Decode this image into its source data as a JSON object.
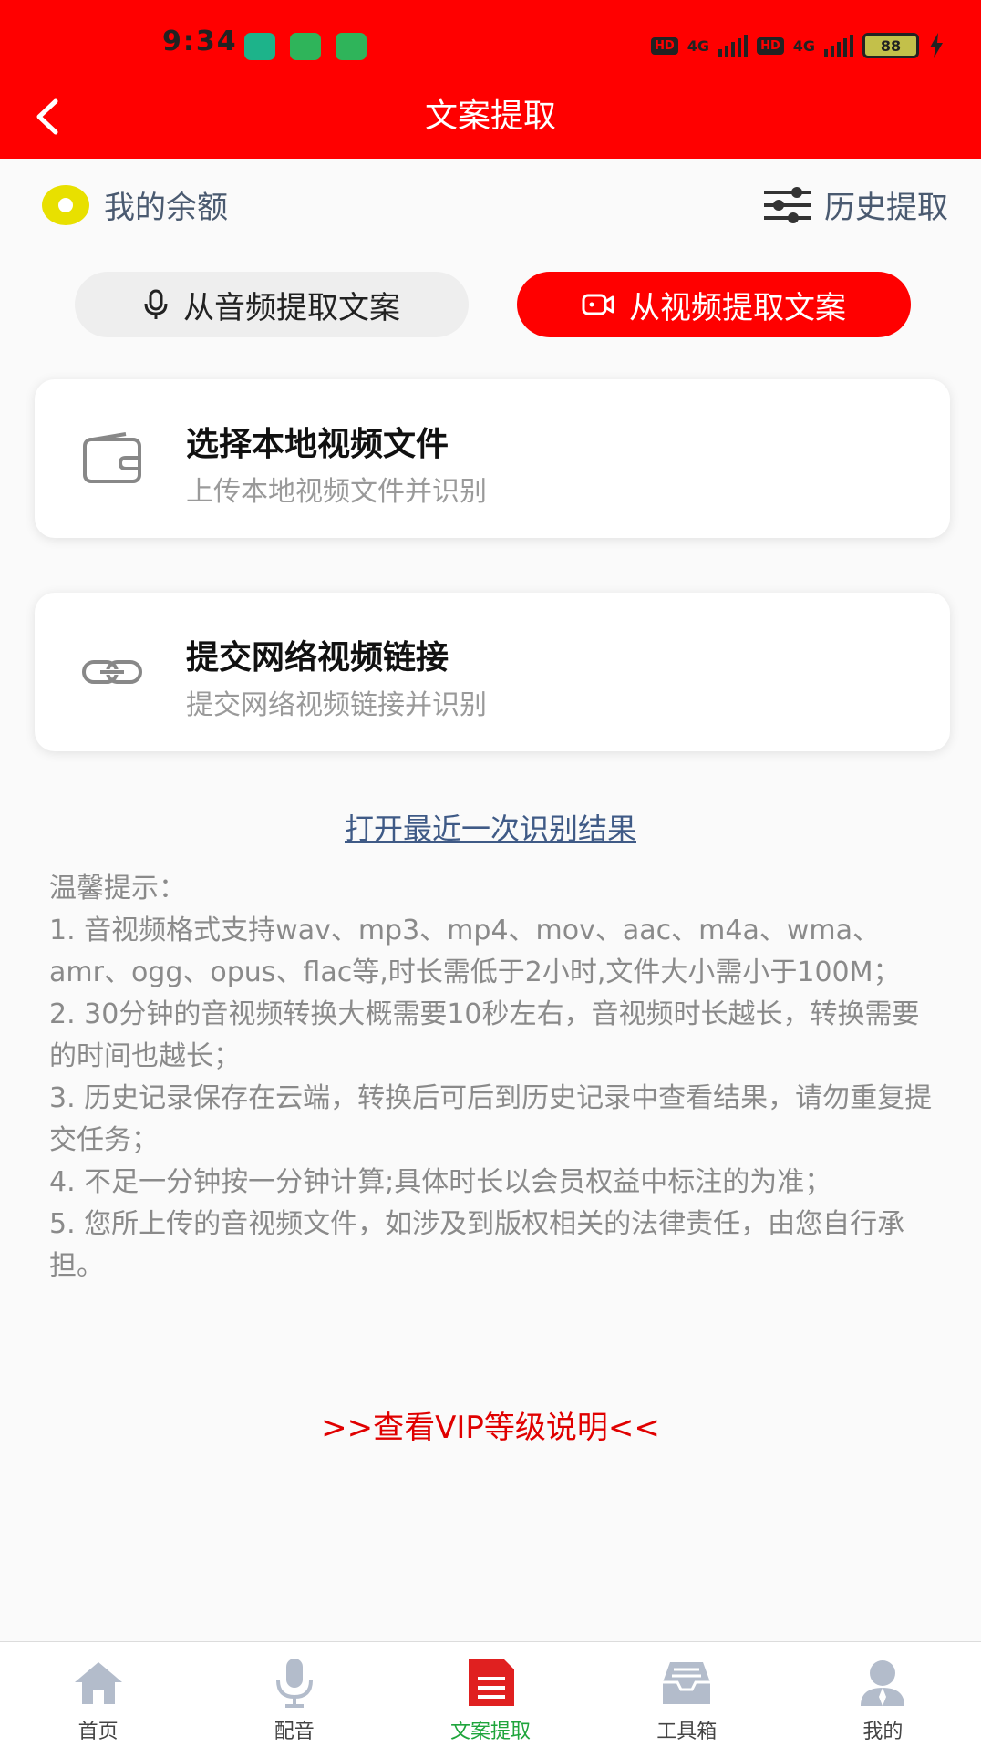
{
  "status_bar": {
    "time": "9:34",
    "hd_badge_1": "HD",
    "net_1": "4G",
    "hd_badge_2": "HD",
    "net_2": "4G",
    "battery": "88"
  },
  "header": {
    "title": "文案提取",
    "background_color": "#ff0000"
  },
  "balance": {
    "label": "我的余额"
  },
  "history": {
    "label": "历史提取"
  },
  "modes": {
    "audio_label": "从音频提取文案",
    "video_label": "从视频提取文案",
    "selected": "video"
  },
  "cards": [
    {
      "title": "选择本地视频文件",
      "subtitle": "上传本地视频文件并识别",
      "icon": "wallet-icon"
    },
    {
      "title": "提交网络视频链接",
      "subtitle": "提交网络视频链接并识别",
      "icon": "link-icon"
    }
  ],
  "recent_link": "打开最近一次识别结果",
  "tips": {
    "heading": "温馨提示：",
    "lines": [
      "1. 音视频格式支持wav、mp3、mp4、mov、aac、m4a、wma、amr、ogg、opus、flac等,时长需低于2小时,文件大小需小于100M；",
      "2. 30分钟的音视频转换大概需要10秒左右，音视频时长越长，转换需要的时间也越长；",
      "3. 历史记录保存在云端，转换后可后到历史记录中查看结果，请勿重复提交任务；",
      "4. 不足一分钟按一分钟计算;具体时长以会员权益中标注的为准；",
      "5. 您所上传的音视频文件，如涉及到版权相关的法律责任，由您自行承担。"
    ]
  },
  "vip_link": ">>查看VIP等级说明<<",
  "tabs": [
    {
      "label": "首页",
      "icon": "home-icon"
    },
    {
      "label": "配音",
      "icon": "microphone-icon"
    },
    {
      "label": "文案提取",
      "icon": "document-icon",
      "active": true
    },
    {
      "label": "工具箱",
      "icon": "toolbox-icon"
    },
    {
      "label": "我的",
      "icon": "user-icon"
    }
  ],
  "active_tab_color": "#1fa53c"
}
